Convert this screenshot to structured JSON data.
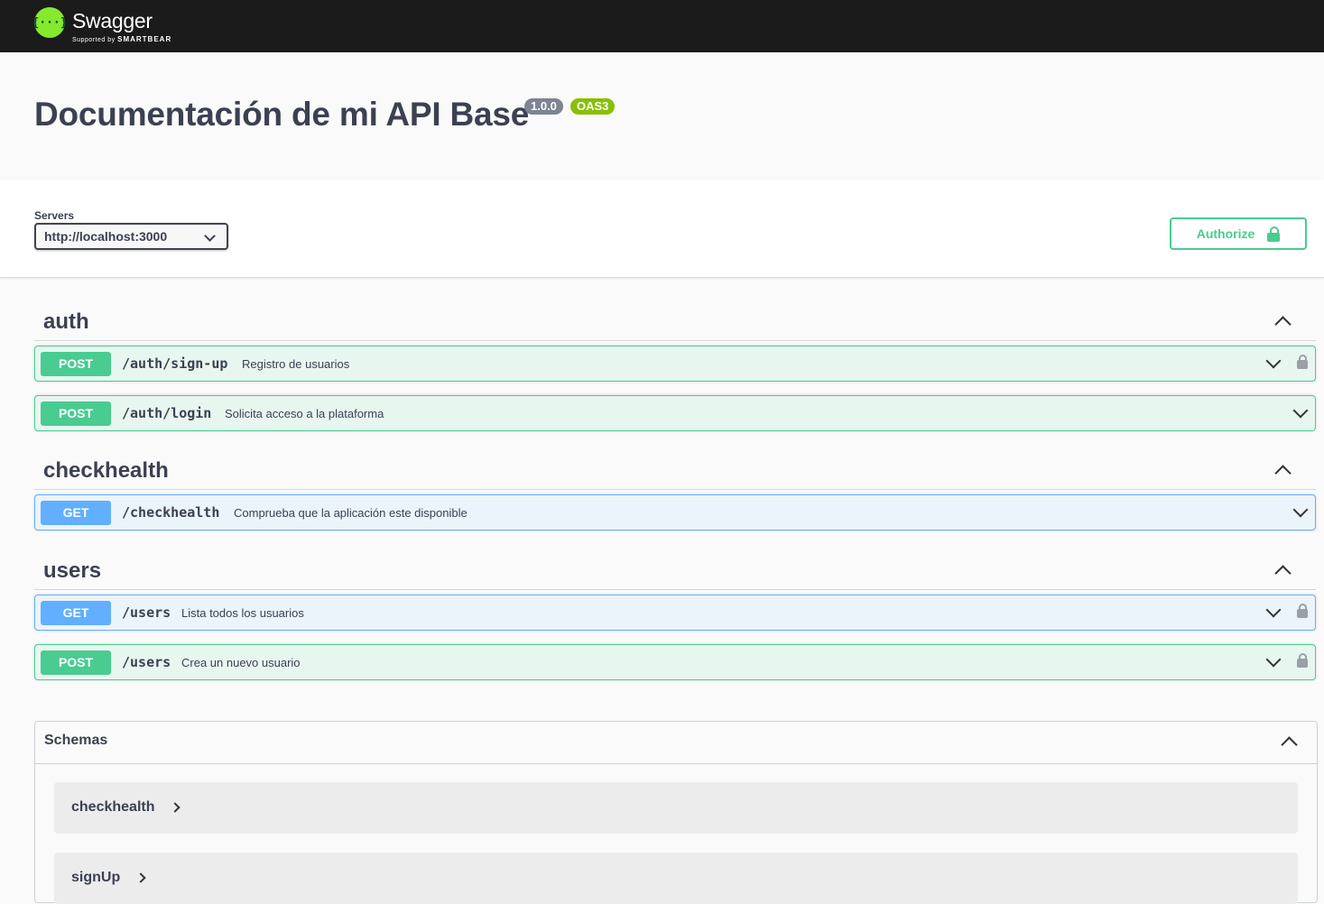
{
  "topbar": {
    "logo_glyph": "{···}",
    "brand": "Swagger",
    "supported_by": "Supported by",
    "supported_company": "SMARTBEAR"
  },
  "info": {
    "title": "Documentación de mi API Base",
    "version": "1.0.0",
    "oas": "OAS3"
  },
  "servers": {
    "label": "Servers",
    "selected": "http://localhost:3000"
  },
  "authorize": {
    "label": "Authorize"
  },
  "tags": [
    {
      "name": "auth",
      "operations": [
        {
          "method": "POST",
          "path": "/auth/sign-up",
          "summary": "Registro de usuarios",
          "locked": true
        },
        {
          "method": "POST",
          "path": "/auth/login",
          "summary": "Solicita acceso a la plataforma",
          "locked": false
        }
      ]
    },
    {
      "name": "checkhealth",
      "operations": [
        {
          "method": "GET",
          "path": "/checkhealth",
          "summary": "Comprueba que la aplicación este disponible",
          "locked": false
        }
      ]
    },
    {
      "name": "users",
      "operations": [
        {
          "method": "GET",
          "path": "/users",
          "summary": "Lista todos los usuarios",
          "locked": true
        },
        {
          "method": "POST",
          "path": "/users",
          "summary": "Crea un nuevo usuario",
          "locked": true
        }
      ]
    }
  ],
  "schemas": {
    "title": "Schemas",
    "models": [
      "checkhealth",
      "signUp"
    ]
  },
  "colors": {
    "post": "#49cc90",
    "get": "#61affe",
    "brand_green": "#85ea2d",
    "topbar": "#1b1b1b"
  }
}
